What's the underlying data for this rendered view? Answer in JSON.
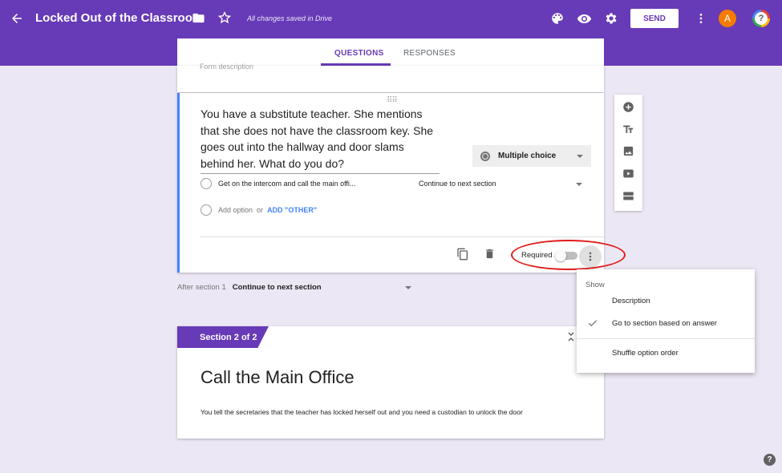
{
  "header": {
    "title": "Locked Out of the Classroom",
    "save_status": "All changes saved in Drive",
    "send_label": "SEND",
    "avatar_letter": "A",
    "help_glyph": "?"
  },
  "tabs": {
    "questions": "QUESTIONS",
    "responses": "RESPONSES"
  },
  "form": {
    "description_placeholder": "Form description"
  },
  "question": {
    "text": "You have a substitute teacher. She mentions that she does not have the classroom key. She goes out into the hallway and door slams behind her. What do you do?",
    "type": "Multiple choice",
    "option_1": "Get on the intercom and call the main offi...",
    "option_1_goto": "Continue to next section",
    "add_option": "Add option",
    "or": "or",
    "add_other": "ADD \"OTHER\"",
    "required_label": "Required",
    "required": false
  },
  "after_section": {
    "label": "After section 1",
    "value": "Continue to next section"
  },
  "section2": {
    "tab_label": "Section 2 of 2",
    "title": "Call the Main Office",
    "description": "You tell the secretaries that the teacher has locked herself out and you need a custodian to unlock the door"
  },
  "menu": {
    "header": "Show",
    "items": [
      "Description",
      "Go to section based on answer",
      "Shuffle option order"
    ],
    "checked_index": 1
  },
  "colors": {
    "brand": "#673ab7",
    "accent_blue": "#4285f4",
    "annotation_red": "#e01b1b"
  }
}
